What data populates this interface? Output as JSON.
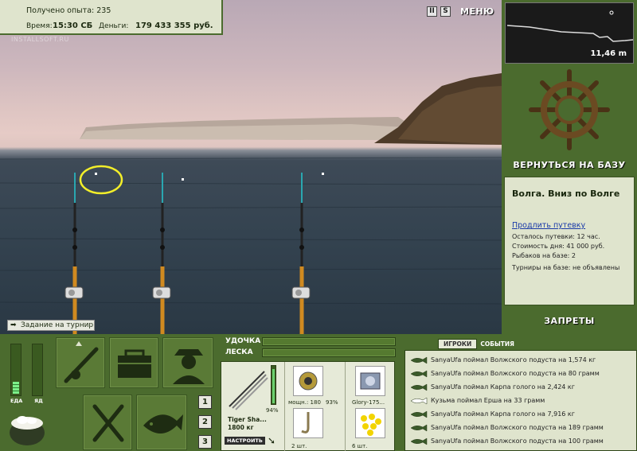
{
  "stats": {
    "experience": "Получено опыта: 235",
    "time_label": "Время:",
    "time_value": "15:30 СБ",
    "money_label": "Деньги:",
    "money_value": "179 433 355 руб."
  },
  "watermark": "INSTALLSOFT.RU",
  "top_controls": {
    "pause": "II",
    "sound": "S",
    "menu": "МЕНЮ"
  },
  "task_button": "Задание на турнир",
  "depth": {
    "value": "11,46 m"
  },
  "return_to_base": "ВЕРНУТЬСЯ НА БАЗУ",
  "location": {
    "title": "Волга. Вниз по Волге",
    "extend_link": "Продлить путевку",
    "info": [
      "Осталось путевки: 12 час.",
      "Стоимость дня: 41 000 руб.",
      "Рыбаков на базе: 2",
      "Турниры на базе: не объявлены"
    ]
  },
  "bans": "ЗАПРЕТЫ",
  "meters": [
    {
      "label": "ЕДА",
      "level": 0.25
    },
    {
      "label": "ЯД",
      "level": 0.0
    }
  ],
  "rod_numbers": [
    "1",
    "2",
    "3"
  ],
  "gear": {
    "rod_label": "УДОЧКА",
    "line_label": "ЛЕСКА",
    "rod_name": "Tiger Sha...",
    "rod_capacity": "1800 кг",
    "rod_percent": "94%",
    "setup_button": "НАСТРОИТЬ",
    "reel_power": "мощн.: 180",
    "reel_percent": "93%",
    "line_name": "Glory-175...",
    "hooks_count": "2 шт.",
    "bait_count": "6 шт."
  },
  "chat": {
    "tab_players": "ИГРОКИ",
    "tab_events": "СОБЫТИЯ",
    "messages": [
      {
        "text": "SanyaUfa поймал Волжского подуста на 1,574 кг",
        "color": "#3a5a2a"
      },
      {
        "text": "SanyaUfa поймал Волжского подуста на 80 грамм",
        "color": "#3a5a2a"
      },
      {
        "text": "SanyaUfa поймал Карпа голого на 2,424 кг",
        "color": "#3a5a2a"
      },
      {
        "text": "Кузьма поймал Ерша на 33 грамм",
        "color": "#ffffff"
      },
      {
        "text": "SanyaUfa поймал Карпа голого на 7,916 кг",
        "color": "#3a5a2a"
      },
      {
        "text": "SanyaUfa поймал Волжского подуста на 189 грамм",
        "color": "#3a5a2a"
      },
      {
        "text": "SanyaUfa поймал Волжского подуста на 100 грамм",
        "color": "#3a5a2a"
      }
    ]
  }
}
